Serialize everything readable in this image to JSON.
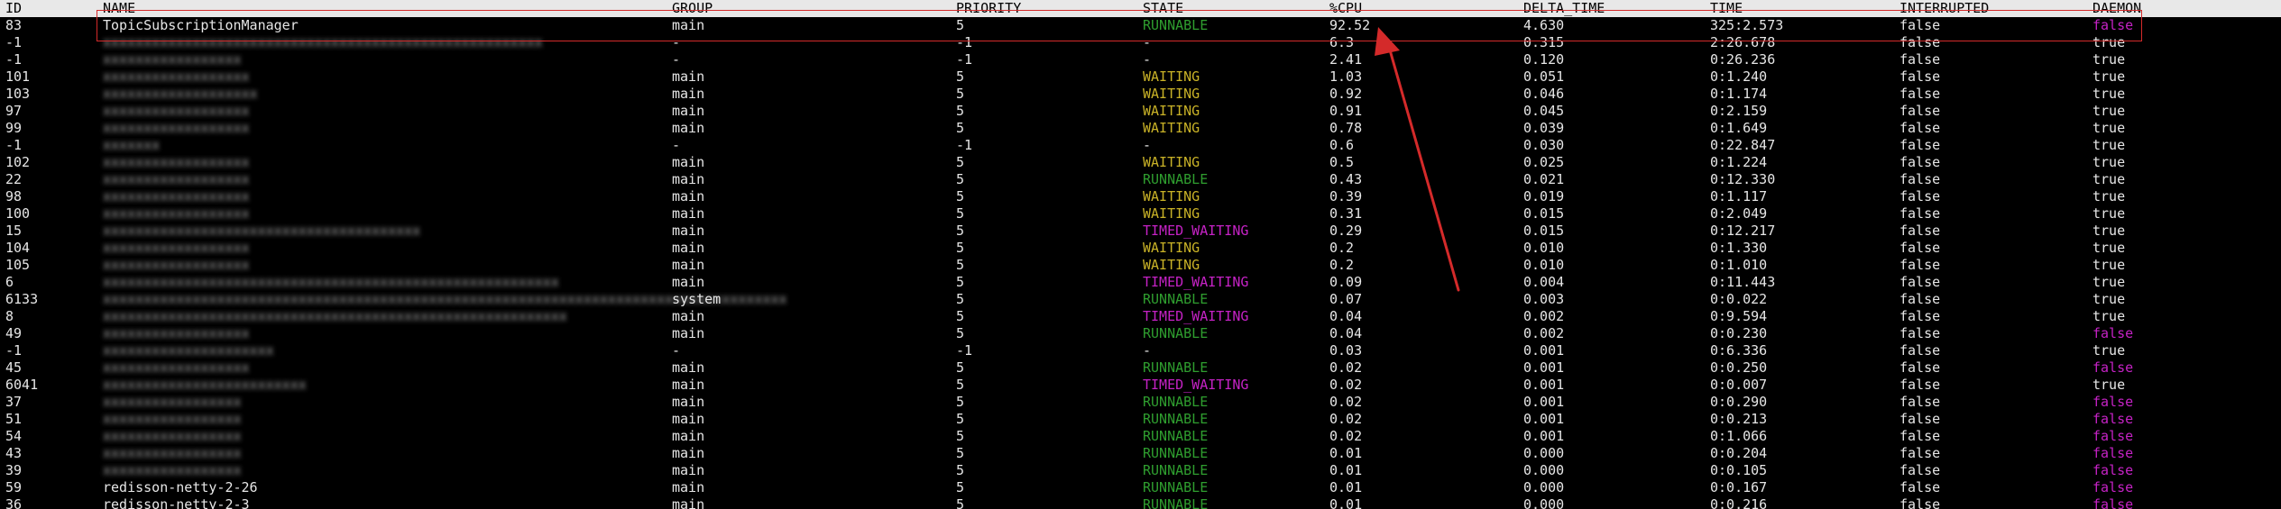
{
  "colors": {
    "background": "#000000",
    "header_bg": "#e8e8e8",
    "text": "#e6e6e6",
    "runnable": "#2f9e2f",
    "waiting": "#c9b227",
    "timed_waiting": "#c522c5",
    "daemon_false": "#c522c5",
    "annotation": "#d42a2a"
  },
  "columns": {
    "id": "ID",
    "name": "NAME",
    "group": "GROUP",
    "priority": "PRIORITY",
    "state": "STATE",
    "cpu": "%CPU",
    "delta_time": "DELTA_TIME",
    "time": "TIME",
    "interrupted": "INTERRUPTED",
    "daemon": "DAEMON"
  },
  "rows": [
    {
      "id": "83",
      "name": "TopicSubscriptionManager",
      "name_obscured": false,
      "group": "main",
      "priority": "5",
      "state": "RUNNABLE",
      "cpu": "92.52",
      "delta_time": "4.630",
      "time": "325:2.573",
      "interrupted": "false",
      "daemon": "false"
    },
    {
      "id": "-1",
      "name": "",
      "name_obscured": true,
      "group": "-",
      "priority": "-1",
      "state": "-",
      "cpu": "6.3",
      "delta_time": "0.315",
      "time": "2:26.678",
      "interrupted": "false",
      "daemon": "true"
    },
    {
      "id": "-1",
      "name": "",
      "name_obscured": true,
      "group": "-",
      "priority": "-1",
      "state": "-",
      "cpu": "2.41",
      "delta_time": "0.120",
      "time": "0:26.236",
      "interrupted": "false",
      "daemon": "true"
    },
    {
      "id": "101",
      "name": "",
      "name_obscured": true,
      "group": "main",
      "priority": "5",
      "state": "WAITING",
      "cpu": "1.03",
      "delta_time": "0.051",
      "time": "0:1.240",
      "interrupted": "false",
      "daemon": "true"
    },
    {
      "id": "103",
      "name": "",
      "name_obscured": true,
      "group": "main",
      "priority": "5",
      "state": "WAITING",
      "cpu": "0.92",
      "delta_time": "0.046",
      "time": "0:1.174",
      "interrupted": "false",
      "daemon": "true"
    },
    {
      "id": "97",
      "name": "",
      "name_obscured": true,
      "group": "main",
      "priority": "5",
      "state": "WAITING",
      "cpu": "0.91",
      "delta_time": "0.045",
      "time": "0:2.159",
      "interrupted": "false",
      "daemon": "true"
    },
    {
      "id": "99",
      "name": "",
      "name_obscured": true,
      "group": "main",
      "priority": "5",
      "state": "WAITING",
      "cpu": "0.78",
      "delta_time": "0.039",
      "time": "0:1.649",
      "interrupted": "false",
      "daemon": "true"
    },
    {
      "id": "-1",
      "name": "",
      "name_obscured": true,
      "group": "-",
      "priority": "-1",
      "state": "-",
      "cpu": "0.6",
      "delta_time": "0.030",
      "time": "0:22.847",
      "interrupted": "false",
      "daemon": "true"
    },
    {
      "id": "102",
      "name": "",
      "name_obscured": true,
      "group": "main",
      "priority": "5",
      "state": "WAITING",
      "cpu": "0.5",
      "delta_time": "0.025",
      "time": "0:1.224",
      "interrupted": "false",
      "daemon": "true"
    },
    {
      "id": "22",
      "name": "",
      "name_obscured": true,
      "group": "main",
      "priority": "5",
      "state": "RUNNABLE",
      "cpu": "0.43",
      "delta_time": "0.021",
      "time": "0:12.330",
      "interrupted": "false",
      "daemon": "true"
    },
    {
      "id": "98",
      "name": "",
      "name_obscured": true,
      "group": "main",
      "priority": "5",
      "state": "WAITING",
      "cpu": "0.39",
      "delta_time": "0.019",
      "time": "0:1.117",
      "interrupted": "false",
      "daemon": "true"
    },
    {
      "id": "100",
      "name": "",
      "name_obscured": true,
      "group": "main",
      "priority": "5",
      "state": "WAITING",
      "cpu": "0.31",
      "delta_time": "0.015",
      "time": "0:2.049",
      "interrupted": "false",
      "daemon": "true"
    },
    {
      "id": "15",
      "name": "",
      "name_obscured": true,
      "group": "main",
      "priority": "5",
      "state": "TIMED_WAITING",
      "cpu": "0.29",
      "delta_time": "0.015",
      "time": "0:12.217",
      "interrupted": "false",
      "daemon": "true"
    },
    {
      "id": "104",
      "name": "",
      "name_obscured": true,
      "group": "main",
      "priority": "5",
      "state": "WAITING",
      "cpu": "0.2",
      "delta_time": "0.010",
      "time": "0:1.330",
      "interrupted": "false",
      "daemon": "true"
    },
    {
      "id": "105",
      "name": "",
      "name_obscured": true,
      "group": "main",
      "priority": "5",
      "state": "WAITING",
      "cpu": "0.2",
      "delta_time": "0.010",
      "time": "0:1.010",
      "interrupted": "false",
      "daemon": "true"
    },
    {
      "id": "6",
      "name": "",
      "name_obscured": true,
      "group": "main",
      "priority": "5",
      "state": "TIMED_WAITING",
      "cpu": "0.09",
      "delta_time": "0.004",
      "time": "0:11.443",
      "interrupted": "false",
      "daemon": "true"
    },
    {
      "id": "6133",
      "name": "",
      "name_obscured": true,
      "group": "system",
      "priority": "5",
      "state": "RUNNABLE",
      "cpu": "0.07",
      "delta_time": "0.003",
      "time": "0:0.022",
      "interrupted": "false",
      "daemon": "true"
    },
    {
      "id": "8",
      "name": "",
      "name_obscured": true,
      "group": "main",
      "priority": "5",
      "state": "TIMED_WAITING",
      "cpu": "0.04",
      "delta_time": "0.002",
      "time": "0:9.594",
      "interrupted": "false",
      "daemon": "true"
    },
    {
      "id": "49",
      "name": "",
      "name_obscured": true,
      "group": "main",
      "priority": "5",
      "state": "RUNNABLE",
      "cpu": "0.04",
      "delta_time": "0.002",
      "time": "0:0.230",
      "interrupted": "false",
      "daemon": "false"
    },
    {
      "id": "-1",
      "name": "",
      "name_obscured": true,
      "group": "-",
      "priority": "-1",
      "state": "-",
      "cpu": "0.03",
      "delta_time": "0.001",
      "time": "0:6.336",
      "interrupted": "false",
      "daemon": "true"
    },
    {
      "id": "45",
      "name": "",
      "name_obscured": true,
      "group": "main",
      "priority": "5",
      "state": "RUNNABLE",
      "cpu": "0.02",
      "delta_time": "0.001",
      "time": "0:0.250",
      "interrupted": "false",
      "daemon": "false"
    },
    {
      "id": "6041",
      "name": "",
      "name_obscured": true,
      "group": "main",
      "priority": "5",
      "state": "TIMED_WAITING",
      "cpu": "0.02",
      "delta_time": "0.001",
      "time": "0:0.007",
      "interrupted": "false",
      "daemon": "true"
    },
    {
      "id": "37",
      "name": "",
      "name_obscured": true,
      "group": "main",
      "priority": "5",
      "state": "RUNNABLE",
      "cpu": "0.02",
      "delta_time": "0.001",
      "time": "0:0.290",
      "interrupted": "false",
      "daemon": "false"
    },
    {
      "id": "51",
      "name": "",
      "name_obscured": true,
      "group": "main",
      "priority": "5",
      "state": "RUNNABLE",
      "cpu": "0.02",
      "delta_time": "0.001",
      "time": "0:0.213",
      "interrupted": "false",
      "daemon": "false"
    },
    {
      "id": "54",
      "name": "",
      "name_obscured": true,
      "group": "main",
      "priority": "5",
      "state": "RUNNABLE",
      "cpu": "0.02",
      "delta_time": "0.001",
      "time": "0:1.066",
      "interrupted": "false",
      "daemon": "false"
    },
    {
      "id": "43",
      "name": "",
      "name_obscured": true,
      "group": "main",
      "priority": "5",
      "state": "RUNNABLE",
      "cpu": "0.01",
      "delta_time": "0.000",
      "time": "0:0.204",
      "interrupted": "false",
      "daemon": "false"
    },
    {
      "id": "39",
      "name": "",
      "name_obscured": true,
      "group": "main",
      "priority": "5",
      "state": "RUNNABLE",
      "cpu": "0.01",
      "delta_time": "0.000",
      "time": "0:0.105",
      "interrupted": "false",
      "daemon": "false"
    },
    {
      "id": "59",
      "name": "redisson-netty-2-26",
      "name_obscured": false,
      "group": "main",
      "priority": "5",
      "state": "RUNNABLE",
      "cpu": "0.01",
      "delta_time": "0.000",
      "time": "0:0.167",
      "interrupted": "false",
      "daemon": "false"
    },
    {
      "id": "36",
      "name": "redisson-netty-2-3",
      "name_obscured": false,
      "group": "main",
      "priority": "5",
      "state": "RUNNABLE",
      "cpu": "0.01",
      "delta_time": "0.000",
      "time": "0:0.216",
      "interrupted": "false",
      "daemon": "false"
    }
  ]
}
